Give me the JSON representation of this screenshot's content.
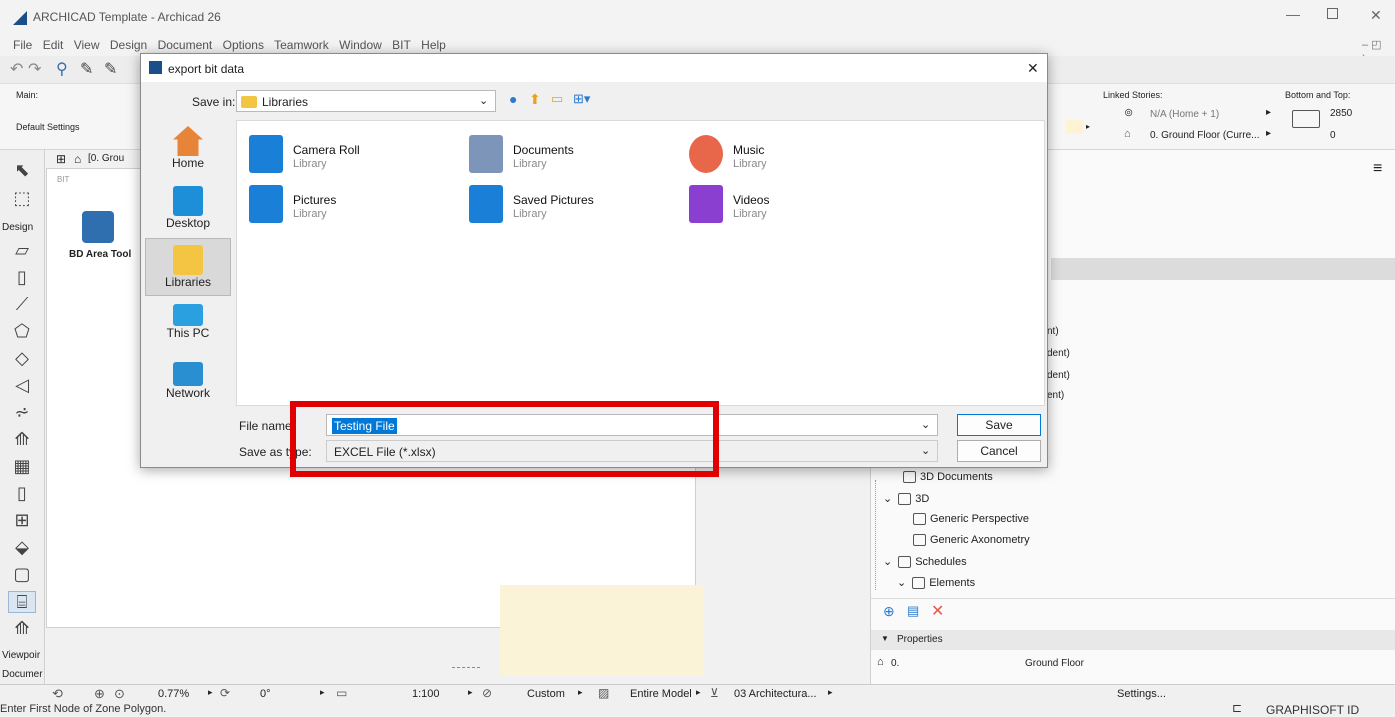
{
  "app": {
    "window_title": "ARCHICAD Template - Archicad 26",
    "menu": [
      "File",
      "Edit",
      "View",
      "Design",
      "Document",
      "Options",
      "Teamwork",
      "Window",
      "BIT",
      "Help"
    ],
    "info": {
      "main_label": "Main:",
      "default_settings": "Default Settings",
      "linked_stories_label": "Linked Stories:",
      "linked_story_top": "N/A (Home + 1)",
      "linked_story_bottom": "0. Ground Floor (Curre...",
      "bottom_top_label": "Bottom and Top:",
      "top_value": "2850",
      "bottom_value": "0"
    },
    "toolbox": {
      "design_label": "Design",
      "viewpoint_label": "Viewpoir",
      "document_label": "Documer"
    },
    "palette": {
      "bit_label": "BIT",
      "tool_name": "BD Area Tool",
      "tab_label": "[0. Grou"
    },
    "right_panel": {
      "partial_lines": [
        "nt)",
        "dent)",
        "dent)",
        "ent)"
      ],
      "tree": [
        {
          "label": "3D Documents",
          "indent": 0
        },
        {
          "label": "3D",
          "indent": 0
        },
        {
          "label": "Generic Perspective",
          "indent": 1
        },
        {
          "label": "Generic Axonometry",
          "indent": 1
        },
        {
          "label": "Schedules",
          "indent": 0
        },
        {
          "label": "Elements",
          "indent": 1
        }
      ],
      "properties_label": "Properties",
      "story_num": "0.",
      "story_name": "Ground Floor",
      "settings_btn": "Settings...",
      "graphisoft_id": "GRAPHISOFT ID"
    },
    "status": {
      "zoom": "0.77%",
      "angle": "0°",
      "scale": "1:100",
      "pen_set": "Custom",
      "model_view": "Entire Model",
      "layer": "03 Architectura...",
      "prompt": "Enter First Node of Zone Polygon."
    }
  },
  "dialog": {
    "title": "export bit data",
    "save_in_label": "Save in:",
    "save_in_value": "Libraries",
    "places": [
      {
        "label": "Home",
        "icon": "home-icon"
      },
      {
        "label": "Desktop",
        "icon": "desktop-icon"
      },
      {
        "label": "Libraries",
        "icon": "libraries-icon"
      },
      {
        "label": "This PC",
        "icon": "this-pc-icon"
      },
      {
        "label": "Network",
        "icon": "network-icon"
      }
    ],
    "files": [
      {
        "name": "Camera Roll",
        "type": "Library"
      },
      {
        "name": "Documents",
        "type": "Library"
      },
      {
        "name": "Music",
        "type": "Library"
      },
      {
        "name": "Pictures",
        "type": "Library"
      },
      {
        "name": "Saved Pictures",
        "type": "Library"
      },
      {
        "name": "Videos",
        "type": "Library"
      }
    ],
    "file_name_label": "File name:",
    "file_name_value": "Testing File",
    "save_as_type_label": "Save as type:",
    "save_as_type_value": "EXCEL File (*.xlsx)",
    "save_btn": "Save",
    "cancel_btn": "Cancel",
    "close_glyph": "✕"
  },
  "colors": {
    "highlight_box": "#e00000",
    "accent": "#0078d7"
  }
}
